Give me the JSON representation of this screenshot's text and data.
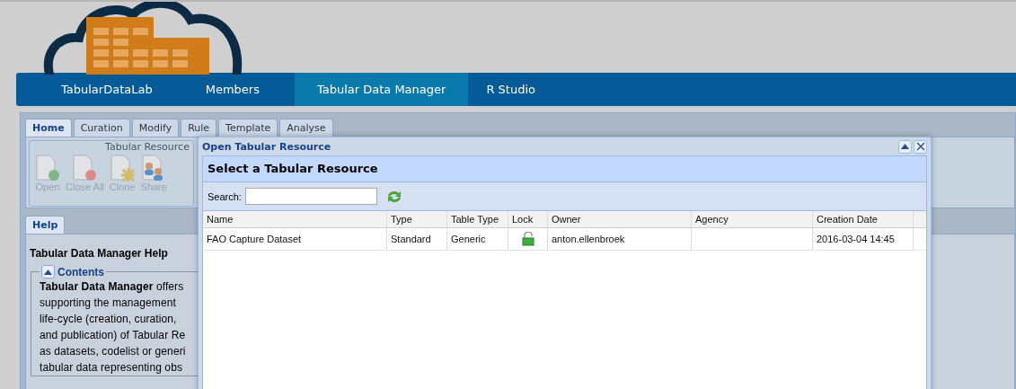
{
  "nav": [
    {
      "label": "TabularDataLab",
      "selected": false
    },
    {
      "label": "Members",
      "selected": false
    },
    {
      "label": "Tabular Data Manager",
      "selected": true
    },
    {
      "label": "R Studio",
      "selected": false
    }
  ],
  "tabs": [
    {
      "label": "Home",
      "selected": true
    },
    {
      "label": "Curation",
      "selected": false
    },
    {
      "label": "Modify",
      "selected": false
    },
    {
      "label": "Rule",
      "selected": false
    },
    {
      "label": "Template",
      "selected": false
    },
    {
      "label": "Analyse",
      "selected": false
    }
  ],
  "ribbon": {
    "group": "Tabular Resource",
    "buttons": [
      {
        "label": "Open",
        "kind": "open",
        "disabled": true
      },
      {
        "label": "Close All",
        "kind": "close",
        "disabled": true
      },
      {
        "label": "Clone",
        "kind": "clone",
        "disabled": true
      },
      {
        "label": "Share",
        "kind": "share",
        "disabled": true
      }
    ]
  },
  "help": {
    "tab": "Help",
    "title": "Tabular Data Manager Help",
    "contents": "Contents",
    "expanded": true,
    "lines": [
      "**Tabular Data Manager** offers",
      "supporting the management",
      "life-cycle (creation, curation,",
      "and publication) of Tabular Re",
      "as datasets, codelist or generi",
      "tabular data representing obs"
    ]
  },
  "dialog": {
    "title": "Open Tabular Resource",
    "heading": "Select a Tabular Resource",
    "search_label": "Search:",
    "columns": [
      "Name",
      "Type",
      "Table Type",
      "Lock",
      "Owner",
      "Agency",
      "Creation Date"
    ],
    "rows": [
      {
        "cells": [
          "FAO Capture Dataset",
          "Standard",
          "Generic",
          "",
          "anton.ellenbroek",
          "",
          "2016-03-04 14:45"
        ],
        "locked": false
      }
    ]
  }
}
